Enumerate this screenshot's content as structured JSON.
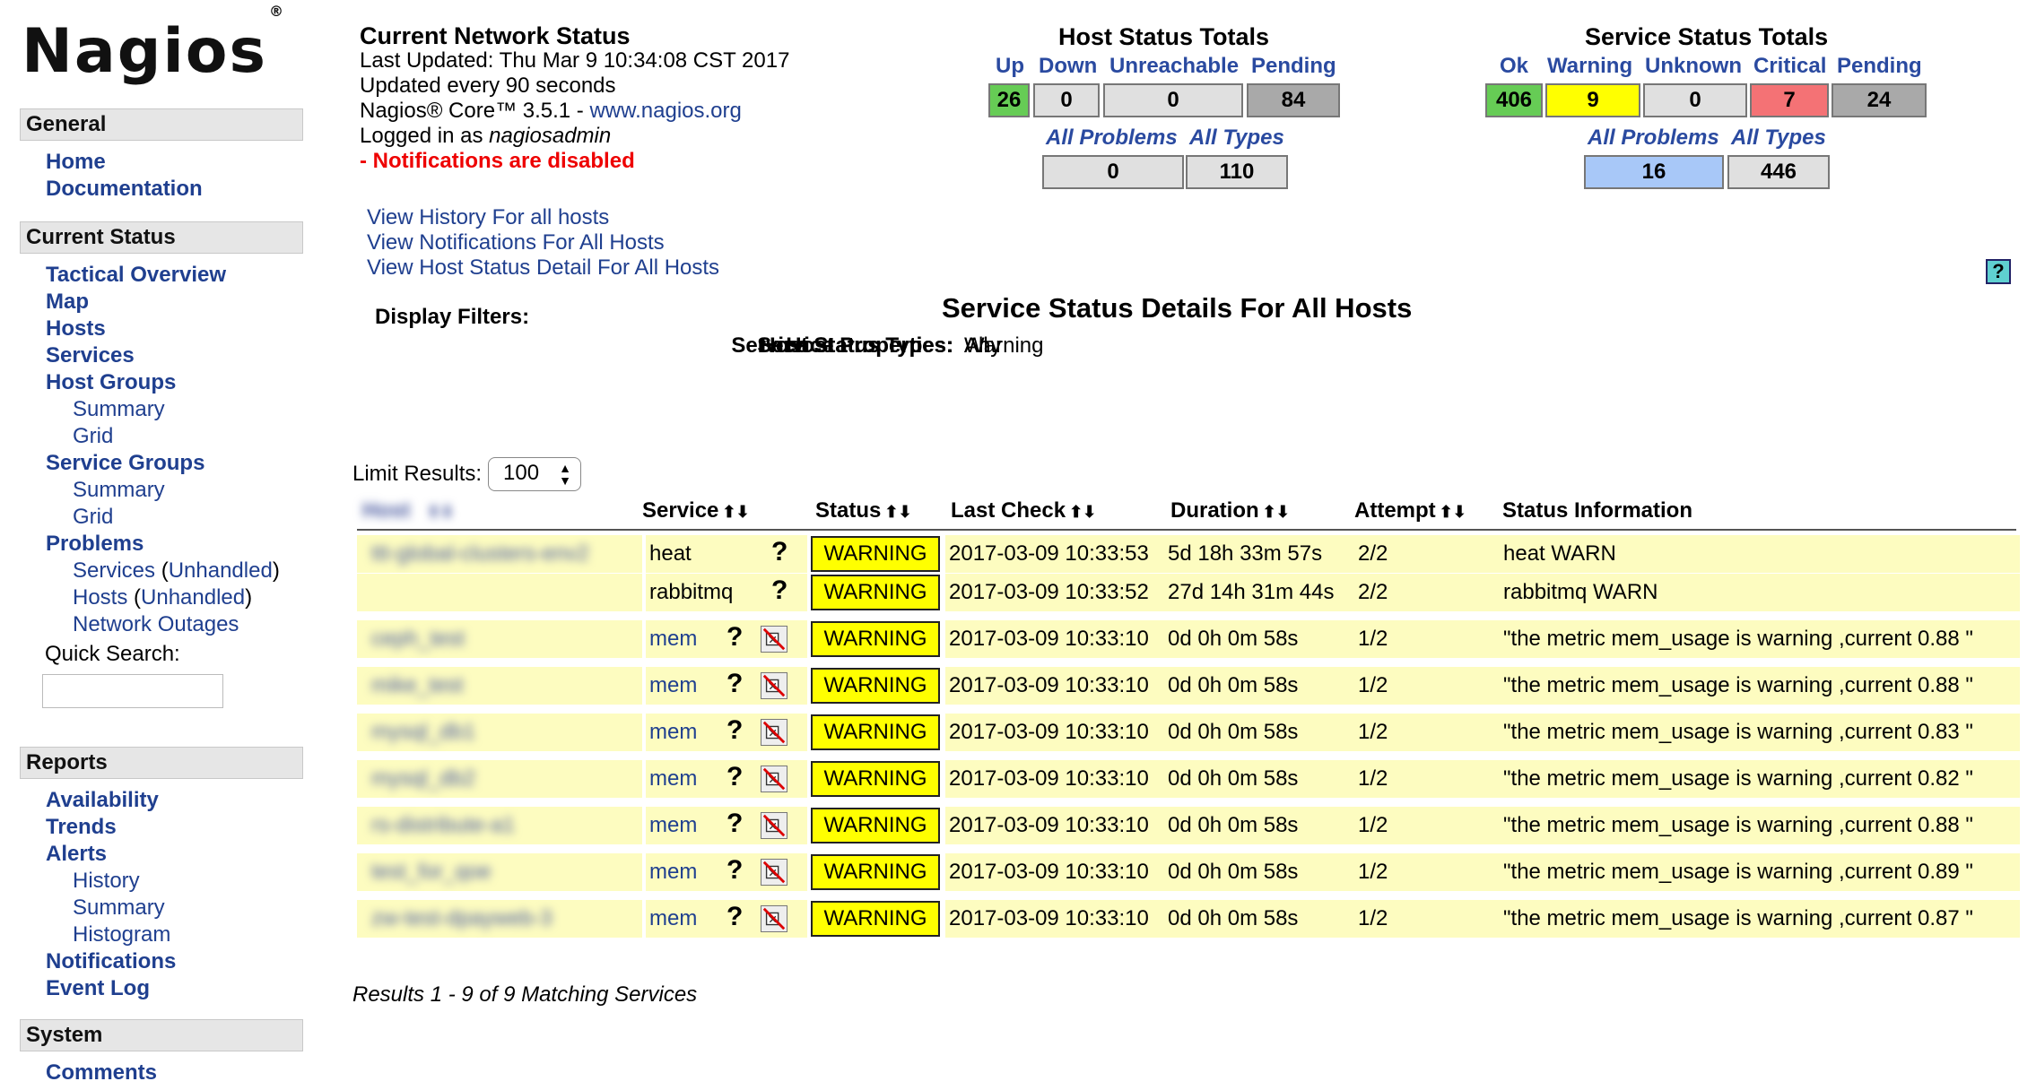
{
  "logo": {
    "text": "Nagios",
    "mark": "®"
  },
  "sidebar": {
    "general": {
      "title": "General",
      "items": [
        "Home",
        "Documentation"
      ]
    },
    "current_status": {
      "title": "Current Status",
      "tactical": "Tactical Overview",
      "map": "Map",
      "hosts": "Hosts",
      "services": "Services",
      "host_groups": "Host Groups",
      "hg_summary": "Summary",
      "hg_grid": "Grid",
      "service_groups": "Service Groups",
      "sg_summary": "Summary",
      "sg_grid": "Grid",
      "problems": "Problems",
      "prob_services": "Services",
      "prob_services_unh": "Unhandled",
      "prob_hosts": "Hosts",
      "prob_hosts_unh": "Unhandled",
      "network_outages": "Network Outages"
    },
    "quick_search": "Quick Search:",
    "reports": {
      "title": "Reports",
      "availability": "Availability",
      "trends": "Trends",
      "alerts": "Alerts",
      "history": "History",
      "summary": "Summary",
      "histogram": "Histogram",
      "notifications": "Notifications",
      "event_log": "Event Log"
    },
    "system": {
      "title": "System",
      "comments": "Comments"
    }
  },
  "status_info": {
    "title": "Current Network Status",
    "last_updated": "Last Updated: Thu Mar 9 10:34:08 CST 2017",
    "update_interval": "Updated every 90 seconds",
    "core_prefix": "Nagios® Core™ 3.5.1 - ",
    "core_link": "www.nagios.org",
    "logged_in_prefix": "Logged in as ",
    "user": "nagiosadmin",
    "notifications": "- Notifications are disabled",
    "links": [
      "View History For all hosts",
      "View Notifications For All Hosts",
      "View Host Status Detail For All Hosts"
    ]
  },
  "host_totals": {
    "title": "Host Status Totals",
    "labels": {
      "up": "Up",
      "down": "Down",
      "unreachable": "Unreachable",
      "pending": "Pending",
      "all_problems": "All Problems",
      "all_types": "All Types"
    },
    "values": {
      "up": "26",
      "down": "0",
      "unreachable": "0",
      "pending": "84",
      "all_problems": "0",
      "all_types": "110"
    }
  },
  "service_totals": {
    "title": "Service Status Totals",
    "labels": {
      "ok": "Ok",
      "warning": "Warning",
      "unknown": "Unknown",
      "critical": "Critical",
      "pending": "Pending",
      "all_problems": "All Problems",
      "all_types": "All Types"
    },
    "values": {
      "ok": "406",
      "warning": "9",
      "unknown": "0",
      "critical": "7",
      "pending": "24",
      "all_problems": "16",
      "all_types": "446"
    }
  },
  "colors": {
    "ok": "#66cc55",
    "warning": "#ffff00",
    "critical": "#f47275",
    "pending": "#a9a9a9",
    "neutral": "#e0e0e0",
    "problems": "#a8c8f8",
    "row": "#fdfcc0"
  },
  "page_title": "Service Status Details For All Hosts",
  "filters": {
    "heading": "Display Filters:",
    "rows": [
      {
        "k": "Host Status Types:",
        "v": "All"
      },
      {
        "k": "Host Properties:",
        "v": "Any"
      },
      {
        "k": "Service Status Types:",
        "v": "Warning"
      },
      {
        "k": "Service Properties:",
        "v": "Any"
      }
    ]
  },
  "limit": {
    "label": "Limit Results:",
    "value": "100"
  },
  "table": {
    "headers": {
      "host": "Host",
      "service": "Service",
      "status": "Status",
      "last_check": "Last Check",
      "duration": "Duration",
      "attempt": "Attempt",
      "info": "Status Information"
    },
    "rows": [
      {
        "host": "ttt-global-clusters-env2",
        "service": "heat",
        "status": "WARNING",
        "last_check": "2017-03-09 10:33:53",
        "duration": "5d 18h 33m 57s",
        "attempt": "2/2",
        "info": "heat WARN"
      },
      {
        "host": "",
        "service": "rabbitmq",
        "status": "WARNING",
        "last_check": "2017-03-09 10:33:52",
        "duration": "27d 14h 31m 44s",
        "attempt": "2/2",
        "info": "rabbitmq WARN"
      },
      {
        "host": "ceph_test",
        "service": "mem",
        "status": "WARNING",
        "last_check": "2017-03-09 10:33:10",
        "duration": "0d 0h 0m 58s",
        "attempt": "1/2",
        "info": "\"the metric mem_usage is warning ,current 0.88 \""
      },
      {
        "host": "mike_test",
        "service": "mem",
        "status": "WARNING",
        "last_check": "2017-03-09 10:33:10",
        "duration": "0d 0h 0m 58s",
        "attempt": "1/2",
        "info": "\"the metric mem_usage is warning ,current 0.88 \""
      },
      {
        "host": "mysql_db1",
        "service": "mem",
        "status": "WARNING",
        "last_check": "2017-03-09 10:33:10",
        "duration": "0d 0h 0m 58s",
        "attempt": "1/2",
        "info": "\"the metric mem_usage is warning ,current 0.83 \""
      },
      {
        "host": "mysql_db2",
        "service": "mem",
        "status": "WARNING",
        "last_check": "2017-03-09 10:33:10",
        "duration": "0d 0h 0m 58s",
        "attempt": "1/2",
        "info": "\"the metric mem_usage is warning ,current 0.82 \""
      },
      {
        "host": "rs-distribute-a1",
        "service": "mem",
        "status": "WARNING",
        "last_check": "2017-03-09 10:33:10",
        "duration": "0d 0h 0m 58s",
        "attempt": "1/2",
        "info": "\"the metric mem_usage is warning ,current 0.88 \""
      },
      {
        "host": "test_for_qoe",
        "service": "mem",
        "status": "WARNING",
        "last_check": "2017-03-09 10:33:10",
        "duration": "0d 0h 0m 58s",
        "attempt": "1/2",
        "info": "\"the metric mem_usage is warning ,current 0.89 \""
      },
      {
        "host": "zw-test-dpayweb-3",
        "service": "mem",
        "status": "WARNING",
        "last_check": "2017-03-09 10:33:10",
        "duration": "0d 0h 0m 58s",
        "attempt": "1/2",
        "info": "\"the metric mem_usage is warning ,current 0.87 \""
      }
    ]
  },
  "results": "Results 1 - 9 of 9 Matching Services",
  "help": "?"
}
